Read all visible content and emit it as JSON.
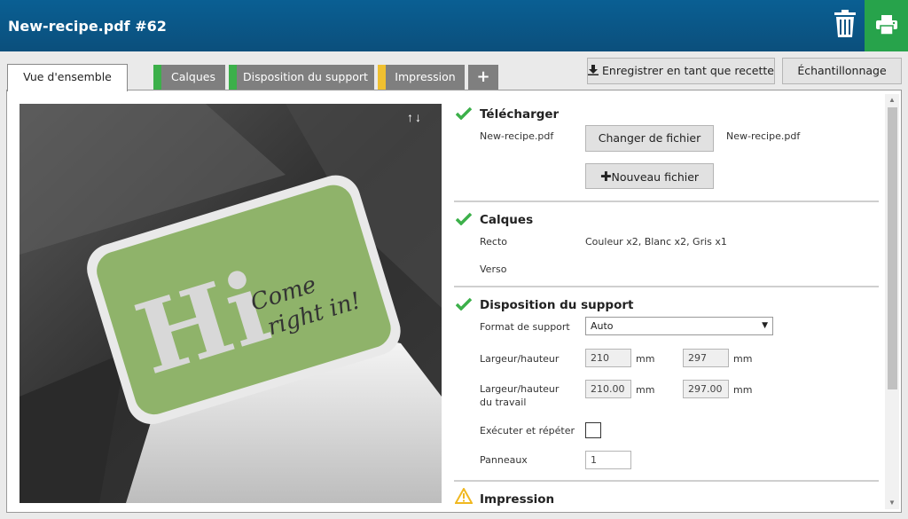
{
  "header": {
    "title": "New-recipe.pdf #62"
  },
  "tabs": [
    {
      "label": "Vue d'ensemble",
      "color": null
    },
    {
      "label": "Calques",
      "color": "#3cb04a"
    },
    {
      "label": "Disposition du support",
      "color": "#3cb04a"
    },
    {
      "label": "Impression",
      "color": "#f0c030"
    },
    {
      "label": "+"
    }
  ],
  "actions": {
    "save_recipe": "Enregistrer en tant que recette",
    "sampling": "Échantillonnage"
  },
  "preview": {
    "big_letters": "Hi",
    "script_line1": "Come",
    "script_line2": "right in!"
  },
  "upload": {
    "title": "Télécharger",
    "file_name": "New-recipe.pdf",
    "change_file": "Changer de fichier",
    "file_name_right": "New-recipe.pdf",
    "new_file": "Nouveau fichier"
  },
  "layers": {
    "title": "Calques",
    "recto_label": "Recto",
    "recto_value": "Couleur x2, Blanc x2, Gris x1",
    "verso_label": "Verso"
  },
  "layout": {
    "title": "Disposition du support",
    "format_label": "Format de support",
    "format_value": "Auto",
    "wh_label": "Largeur/hauteur",
    "width": "210",
    "height": "297",
    "unit": "mm",
    "work_label_1": "Largeur/hauteur",
    "work_label_2": "du travail",
    "work_width": "210.00",
    "work_height": "297.00",
    "repeat_label": "Exécuter et répéter",
    "panels_label": "Panneaux",
    "panels_value": "1"
  },
  "print": {
    "title": "Impression"
  }
}
